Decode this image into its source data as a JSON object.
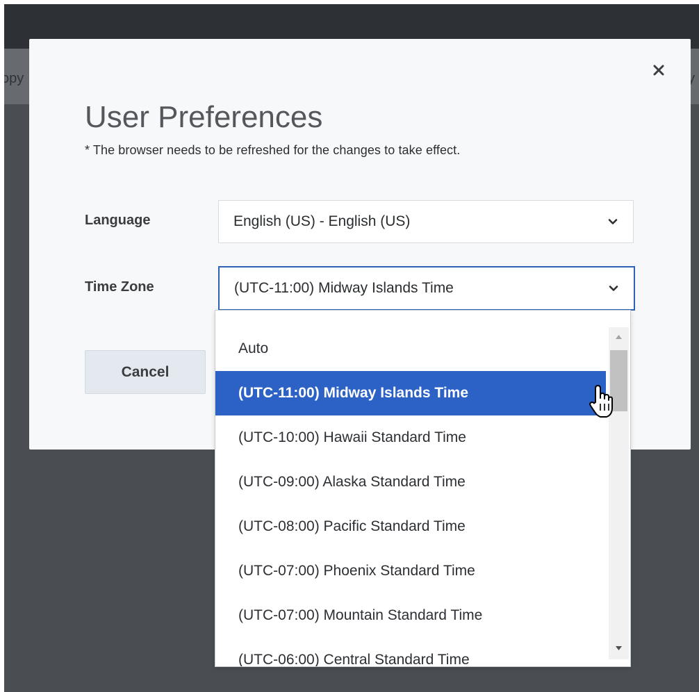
{
  "background": {
    "left_fragment": "opy",
    "right_fragment": "y"
  },
  "modal": {
    "title": "User Preferences",
    "note": "* The browser needs to be refreshed for the changes to take effect.",
    "close_icon": "close-icon",
    "cancel_label": "Cancel"
  },
  "fields": {
    "language": {
      "label": "Language",
      "value": "English (US) - English (US)"
    },
    "timezone": {
      "label": "Time Zone",
      "value": "(UTC-11:00) Midway Islands Time"
    }
  },
  "dropdown": {
    "options": [
      "Auto",
      "(UTC-11:00) Midway Islands Time",
      "(UTC-10:00) Hawaii Standard Time",
      "(UTC-09:00) Alaska Standard Time",
      "(UTC-08:00) Pacific Standard Time",
      "(UTC-07:00) Phoenix Standard Time",
      "(UTC-07:00) Mountain Standard Time",
      "(UTC-06:00) Central Standard Time"
    ],
    "selected_index": 1
  },
  "colors": {
    "accent": "#2c61c5",
    "focus_border": "#2f62b6",
    "modal_bg": "#f7f8f9",
    "overlay": "#4a4e52"
  }
}
